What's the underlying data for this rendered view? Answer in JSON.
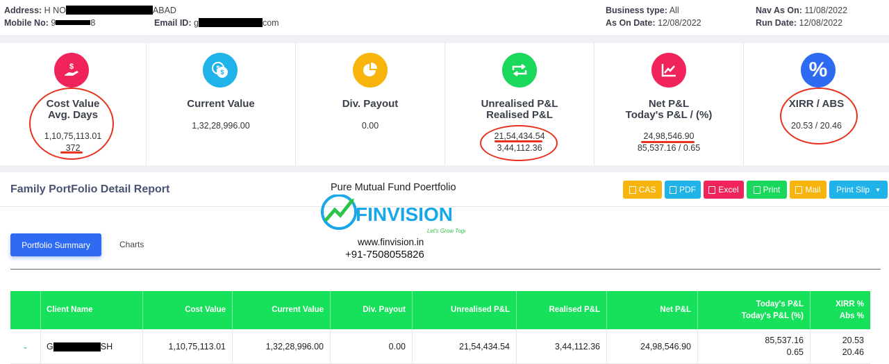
{
  "header": {
    "address_label": "Address:",
    "address_prefix": "H NO",
    "address_suffix": "ABAD",
    "mobile_label": "Mobile No:",
    "mobile_prefix": "9",
    "mobile_suffix": "8",
    "email_label": "Email ID:",
    "email_prefix": "g",
    "email_suffix": "com",
    "business_type_label": "Business type:",
    "business_type_value": "All",
    "as_on_label": "As On Date:",
    "as_on_value": "12/08/2022",
    "nav_label": "Nav As On:",
    "nav_value": "11/08/2022",
    "run_label": "Run Date:",
    "run_value": "12/08/2022"
  },
  "cards": [
    {
      "title1": "Cost Value",
      "title2": "Avg. Days",
      "value1": "1,10,75,113.01",
      "value2": "372",
      "icon": "hand-dollar-icon",
      "color": "#f0245a"
    },
    {
      "title1": "Current Value",
      "title2": "",
      "value1": "1,32,28,996.00",
      "value2": "",
      "icon": "money-chat-icon",
      "color": "#1fb3ea"
    },
    {
      "title1": "Div. Payout",
      "title2": "",
      "value1": "0.00",
      "value2": "",
      "icon": "pie-chart-icon",
      "color": "#f6b40c"
    },
    {
      "title1": "Unrealised P&L",
      "title2": "Realised P&L",
      "value1": "21,54,434.54",
      "value2": "3,44,112.36",
      "icon": "repeat-icon",
      "color": "#19d85c"
    },
    {
      "title1": "Net P&L",
      "title2": "Today's P&L / (%)",
      "value1": "24,98,546.90",
      "value2": "85,537.16 / 0.65",
      "icon": "line-chart-icon",
      "color": "#f0245a"
    },
    {
      "title1": "XIRR / ABS",
      "title2": "",
      "value1": "20.53 / 20.46",
      "value2": "",
      "icon": "percent-icon",
      "color": "#2f6bf2"
    }
  ],
  "report": {
    "title": "Family PortFolio Detail Report",
    "buttons": [
      {
        "label": "CAS",
        "color": "#f6b40c"
      },
      {
        "label": "PDF",
        "color": "#1fb3ea"
      },
      {
        "label": "Excel",
        "color": "#f0245a"
      },
      {
        "label": "Print",
        "color": "#19d85c"
      },
      {
        "label": "Mail",
        "color": "#f6b40c"
      },
      {
        "label": "Print Slip",
        "color": "#1fb3ea"
      }
    ],
    "tabs": [
      "Portfolio Summary",
      "Charts"
    ]
  },
  "watermark": {
    "title": "Pure Mutual Fund Poertfolio",
    "brand": "FINVISION",
    "tagline": "Let's Grow Together",
    "site": "www.finvision.in",
    "phone": "+91-7508055826"
  },
  "table": {
    "headers": [
      "",
      "Client Name",
      "Cost Value",
      "Current Value",
      "Div. Payout",
      "Unrealised P&L",
      "Realised P&L",
      "Net P&L",
      "Today's P&L",
      "Today's P&L (%)",
      "XIRR %",
      "Abs %"
    ],
    "row": {
      "client_prefix": "G",
      "client_suffix": "SH",
      "cost_value": "1,10,75,113.01",
      "current_value": "1,32,28,996.00",
      "div_payout": "0.00",
      "unrealised": "21,54,434.54",
      "realised": "3,44,112.36",
      "net": "24,98,546.90",
      "todays_pl": "85,537.16",
      "todays_pct": "0.65",
      "xirr": "20.53",
      "abs": "20.46"
    }
  },
  "annotation_color": "#e8321e"
}
